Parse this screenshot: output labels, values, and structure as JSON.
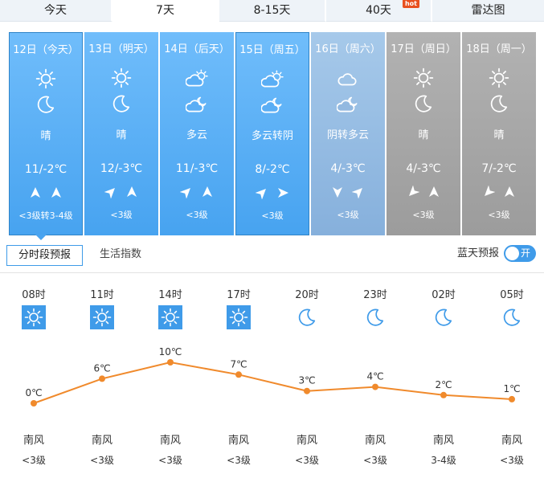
{
  "tabs": [
    {
      "label": "今天",
      "active": false
    },
    {
      "label": "7天",
      "active": true
    },
    {
      "label": "8-15天",
      "active": false
    },
    {
      "label": "40天",
      "active": false,
      "badge": "hot"
    },
    {
      "label": "雷达图",
      "active": false
    }
  ],
  "days": [
    {
      "name": "12日（今天）",
      "icon_day": "sun-icon",
      "icon_night": "moon-icon",
      "desc": "晴",
      "temp": "11/-2℃",
      "wind_icons": [
        "north-wind-arrow-icon",
        "north-wind-arrow-icon"
      ],
      "level": "<3级转3-4级",
      "style": "blue"
    },
    {
      "name": "13日（明天）",
      "icon_day": "sun-icon",
      "icon_night": "moon-icon",
      "desc": "晴",
      "temp": "12/-3℃",
      "wind_icons": [
        "northeast-wind-arrow-icon",
        "north-wind-arrow-icon"
      ],
      "level": "<3级",
      "style": "blue"
    },
    {
      "name": "14日（后天）",
      "icon_day": "partly-cloudy-day-icon",
      "icon_night": "partly-cloudy-night-icon",
      "desc": "多云",
      "temp": "11/-3℃",
      "wind_icons": [
        "northeast-wind-arrow-icon",
        "north-wind-arrow-icon"
      ],
      "level": "<3级",
      "style": "blue"
    },
    {
      "name": "15日（周五）",
      "icon_day": "partly-cloudy-day-icon",
      "icon_night": "partly-cloudy-night-icon",
      "desc": "多云转阴",
      "temp": "8/-2℃",
      "wind_icons": [
        "northeast-wind-arrow-icon",
        "east-wind-arrow-icon"
      ],
      "level": "<3级",
      "style": "blue"
    },
    {
      "name": "16日（周六）",
      "icon_day": "cloud-icon",
      "icon_night": "partly-cloudy-night-icon",
      "desc": "阴转多云",
      "temp": "4/-3℃",
      "wind_icons": [
        "south-wind-arrow-icon",
        "northeast-wind-arrow-icon"
      ],
      "level": "<3级",
      "style": "lightblue"
    },
    {
      "name": "17日（周日）",
      "icon_day": "sun-icon",
      "icon_night": "moon-icon",
      "desc": "晴",
      "temp": "4/-3℃",
      "wind_icons": [
        "southwest-wind-arrow-icon",
        "north-wind-arrow-icon"
      ],
      "level": "<3级",
      "style": "gray"
    },
    {
      "name": "18日（周一）",
      "icon_day": "sun-icon",
      "icon_night": "moon-icon",
      "desc": "晴",
      "temp": "7/-2℃",
      "wind_icons": [
        "southwest-wind-arrow-icon",
        "north-wind-arrow-icon"
      ],
      "level": "<3级",
      "style": "gray"
    }
  ],
  "subtabs": {
    "hourly": "分时段预报",
    "life": "生活指数"
  },
  "blue_sky": {
    "label": "蓝天预报",
    "toggle": "开",
    "on": true
  },
  "hourly": [
    {
      "time": "08时",
      "icon": "sun-icon",
      "temp": 0,
      "temp_label": "0℃",
      "wind": "南风",
      "level": "<3级"
    },
    {
      "time": "11时",
      "icon": "sun-icon",
      "temp": 6,
      "temp_label": "6℃",
      "wind": "南风",
      "level": "<3级"
    },
    {
      "time": "14时",
      "icon": "sun-icon",
      "temp": 10,
      "temp_label": "10℃",
      "wind": "南风",
      "level": "<3级"
    },
    {
      "time": "17时",
      "icon": "sun-icon",
      "temp": 7,
      "temp_label": "7℃",
      "wind": "南风",
      "level": "<3级"
    },
    {
      "time": "20时",
      "icon": "moon-icon",
      "temp": 3,
      "temp_label": "3℃",
      "wind": "南风",
      "level": "<3级"
    },
    {
      "time": "23时",
      "icon": "moon-icon",
      "temp": 4,
      "temp_label": "4℃",
      "wind": "南风",
      "level": "<3级"
    },
    {
      "time": "02时",
      "icon": "moon-icon",
      "temp": 2,
      "temp_label": "2℃",
      "wind": "南风",
      "level": "3-4级"
    },
    {
      "time": "05时",
      "icon": "moon-icon",
      "temp": 1,
      "temp_label": "1℃",
      "wind": "南风",
      "level": "<3级"
    }
  ],
  "colors": {
    "accent": "#3f9be9",
    "line": "#f08a2c",
    "day_blue": "#56acf4",
    "day_lightblue": "#95badf",
    "day_gray": "#a6a6a6"
  }
}
